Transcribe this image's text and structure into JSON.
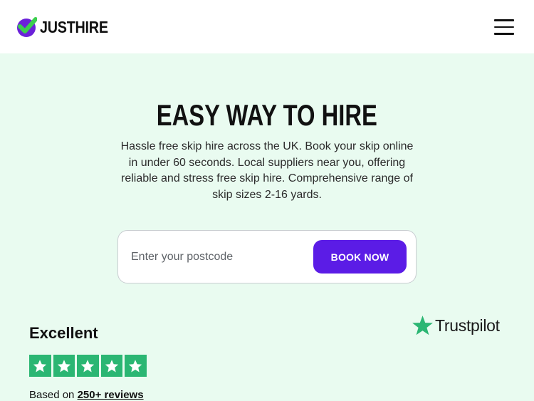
{
  "header": {
    "brand": "JUSTHIRE",
    "logo_icon": "check-logo-icon",
    "menu_icon": "hamburger-menu-icon"
  },
  "hero": {
    "title": "EASY WAY TO HIRE",
    "description": "Hassle free skip hire across the UK. Book your skip online in under 60 seconds. Local suppliers near you, offering reliable and stress free skip hire. Comprehensive range of skip sizes 2-16 yards."
  },
  "search": {
    "placeholder": "Enter your postcode",
    "value": "",
    "button_label": "BOOK NOW"
  },
  "rating": {
    "label": "Excellent",
    "stars": 5,
    "stars_max": 5,
    "reviews_prefix": "Based on",
    "reviews_link": "250+ reviews",
    "provider": "Trustpilot"
  },
  "colors": {
    "accent": "#5b1ce6",
    "hero_bg": "#e9fbf0",
    "star_green": "#2bb673",
    "logo_green": "#3ccf4e",
    "logo_purple": "#6b21d9"
  }
}
